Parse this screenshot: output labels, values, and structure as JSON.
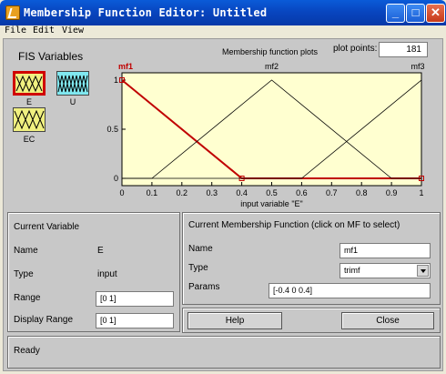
{
  "window": {
    "title": "Membership Function Editor: Untitled"
  },
  "menu": [
    "File",
    "Edit",
    "View"
  ],
  "fis": {
    "title": "FIS Variables",
    "vars": [
      {
        "label": "E",
        "color": "#f0f080",
        "selected": true
      },
      {
        "label": "U",
        "color": "#80e8f0",
        "selected": false
      },
      {
        "label": "EC",
        "color": "#f0f080",
        "selected": false
      }
    ]
  },
  "plot": {
    "title": "Membership function plots",
    "plot_points_label": "plot points:",
    "plot_points_value": "181",
    "xlabel": "input variable \"E\"",
    "background": "#ffffd0",
    "selected_color": "#c00000"
  },
  "chart_data": {
    "type": "line",
    "title": "Membership function plots",
    "xlabel": "input variable \"E\"",
    "ylabel": "",
    "xlim": [
      0,
      1
    ],
    "ylim": [
      0,
      1
    ],
    "x_ticks": [
      "0",
      "0.1",
      "0.2",
      "0.3",
      "0.4",
      "0.5",
      "0.6",
      "0.7",
      "0.8",
      "0.9",
      "1"
    ],
    "y_ticks": [
      "0",
      "0.5",
      "1"
    ],
    "series": [
      {
        "name": "mf1",
        "x": [
          -0.4,
          0,
          0.4,
          1
        ],
        "y": [
          0,
          1,
          0,
          0
        ],
        "selected": true
      },
      {
        "name": "mf2",
        "x": [
          0,
          0.1,
          0.5,
          0.9,
          1
        ],
        "y": [
          0,
          0,
          1,
          0,
          0
        ],
        "selected": false
      },
      {
        "name": "mf3",
        "x": [
          0,
          0.6,
          1.0,
          1.4
        ],
        "y": [
          0,
          0,
          1,
          0
        ],
        "selected": false
      }
    ]
  },
  "current_variable": {
    "title": "Current Variable",
    "name_label": "Name",
    "name_value": "E",
    "type_label": "Type",
    "type_value": "input",
    "range_label": "Range",
    "range_value": "[0 1]",
    "display_range_label": "Display Range",
    "display_range_value": "[0 1]"
  },
  "current_mf": {
    "title": "Current Membership Function (click on MF to select)",
    "name_label": "Name",
    "name_value": "mf1",
    "type_label": "Type",
    "type_value": "trimf",
    "params_label": "Params",
    "params_value": "[-0.4 0 0.4]"
  },
  "buttons": {
    "help": "Help",
    "close": "Close"
  },
  "status": {
    "text": "Ready"
  }
}
